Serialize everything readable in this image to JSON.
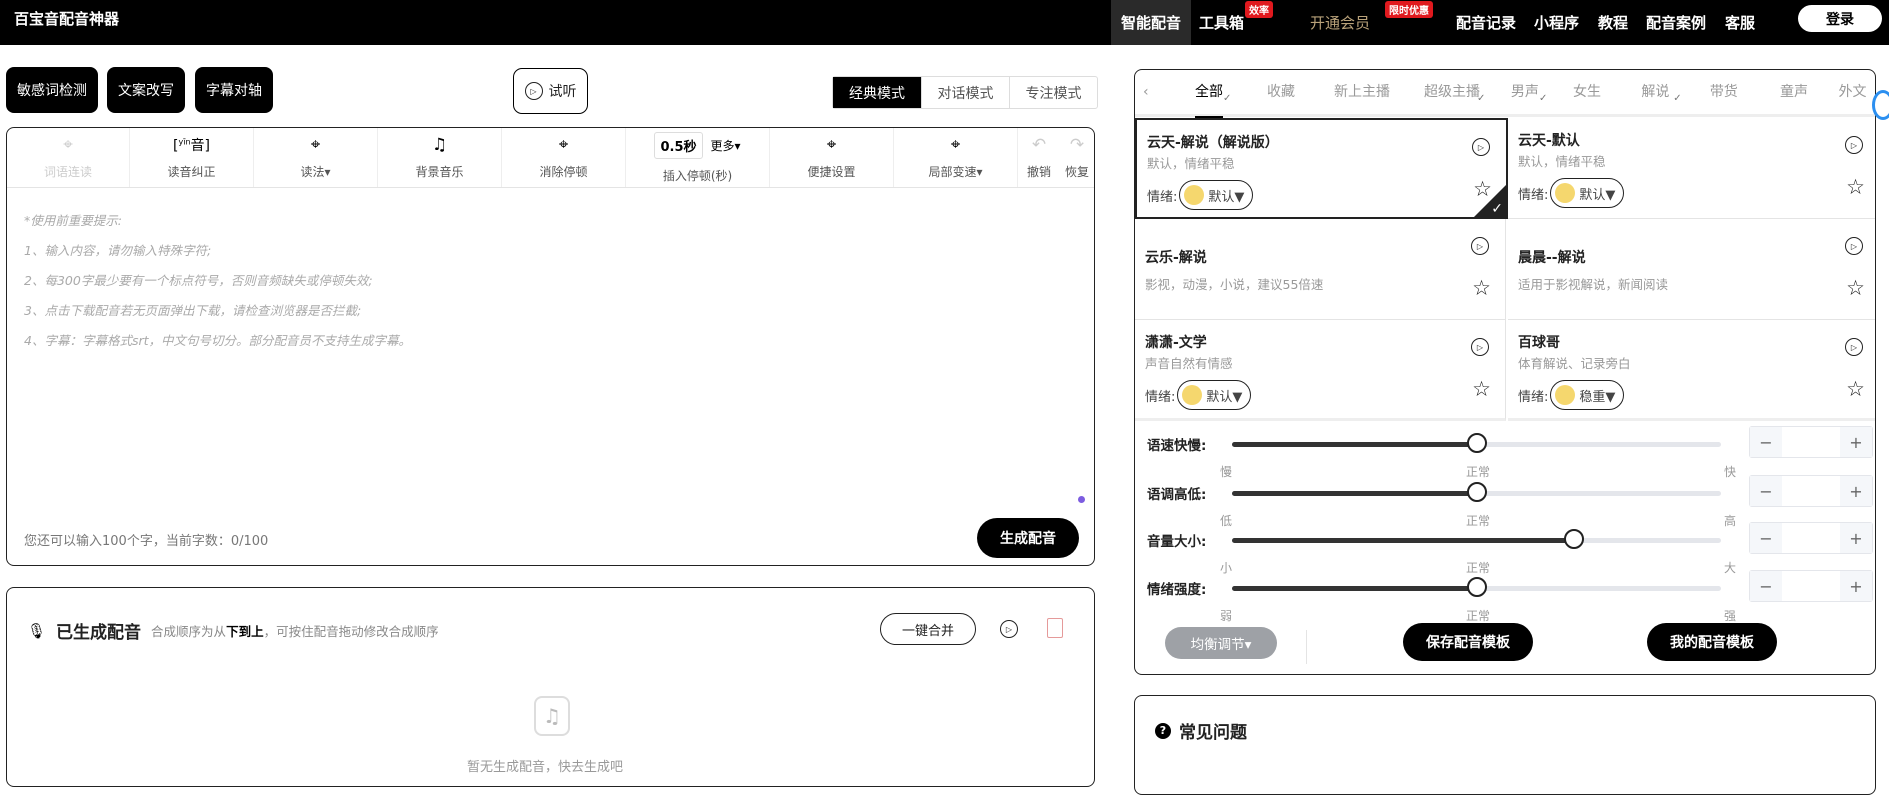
{
  "header": {
    "brand": "百宝音配音神器",
    "nav": [
      {
        "label": "智能配音"
      },
      {
        "label": "工具箱",
        "badge": "效率"
      },
      {
        "label": "开通会员",
        "badge": "限时优惠"
      },
      {
        "label": "配音记录"
      },
      {
        "label": "小程序"
      },
      {
        "label": "教程"
      },
      {
        "label": "配音案例"
      },
      {
        "label": "客服"
      }
    ],
    "login": "登录"
  },
  "actions": {
    "sensitive": "敏感词检测",
    "rewrite": "文案改写",
    "subtitle": "字幕对轴",
    "listen": "试听"
  },
  "modes": [
    "经典模式",
    "对话模式",
    "专注模式"
  ],
  "toolbar": {
    "items": [
      "词语连读",
      "读音纠正",
      "读法▾",
      "背景音乐",
      "消除停顿",
      "插入停顿(秒)",
      "便捷设置",
      "局部变速▾"
    ],
    "pause_value": "0.5秒",
    "more": "更多▾",
    "undo": "撤销",
    "redo": "恢复",
    "pinyin": "yīn",
    "pinyin_char": "音"
  },
  "editor": {
    "hints": [
      "*使用前重要提示:",
      "1、输入内容，请勿输入特殊字符;",
      "2、每300字最少要有一个标点符号，否则音频缺失或停顿失效;",
      "3、点击下载配音若无页面弹出下载，请检查浏览器是否拦截;",
      "4、字幕：字幕格式srt，中文句号切分。部分配音员不支持生成字幕。"
    ],
    "counter": "您还可以输入100个字，当前字数：0/100",
    "generate": "生成配音"
  },
  "generated": {
    "title": "已生成配音",
    "desc_prefix": "合成顺序为从",
    "desc_bold": "下到上",
    "desc_suffix": "，可按住配音拖动修改合成顺序",
    "merge": "一键合并",
    "empty": "暂无生成配音，快去生成吧"
  },
  "voice_tabs": [
    {
      "label": "全部",
      "checked": true
    },
    {
      "label": "收藏"
    },
    {
      "label": "新上主播"
    },
    {
      "label": "超级主播",
      "checked": true
    },
    {
      "label": "男声",
      "checked": true
    },
    {
      "label": "女生"
    },
    {
      "label": "解说",
      "checked": true
    },
    {
      "label": "带货"
    },
    {
      "label": "童声"
    },
    {
      "label": "外文"
    }
  ],
  "voices": [
    {
      "name": "云天-解说（解说版）",
      "desc": "默认，情绪平稳",
      "emotion_label": "情绪:",
      "emotion": "默认▼",
      "selected": true
    },
    {
      "name": "云天-默认",
      "desc": "默认，情绪平稳",
      "emotion_label": "情绪:",
      "emotion": "默认▼"
    },
    {
      "name": "云乐-解说",
      "desc": "影视，动漫，小说，建议55倍速"
    },
    {
      "name": "晨晨--解说",
      "desc": "适用于影视解说，新闻阅读"
    },
    {
      "name": "潇潇-文学",
      "desc": "声音自然有情感",
      "emotion_label": "情绪:",
      "emotion": "默认▼"
    },
    {
      "name": "百球哥",
      "desc": "体育解说、记录旁白",
      "emotion_label": "情绪:",
      "emotion": "稳重▼"
    }
  ],
  "sliders": [
    {
      "label": "语速快慢:",
      "min": "慢",
      "mid": "正常",
      "max": "快",
      "value_pct": 50
    },
    {
      "label": "语调高低:",
      "min": "低",
      "mid": "正常",
      "max": "高",
      "value_pct": 50
    },
    {
      "label": "音量大小:",
      "min": "小",
      "mid": "正常",
      "max": "大",
      "value_pct": 70
    },
    {
      "label": "情绪强度:",
      "min": "弱",
      "mid": "正常",
      "max": "强",
      "value_pct": 50
    }
  ],
  "bottom": {
    "eq": "均衡调节▾",
    "save": "保存配音模板",
    "mine": "我的配音模板"
  },
  "faq": {
    "title": "常见问题"
  }
}
